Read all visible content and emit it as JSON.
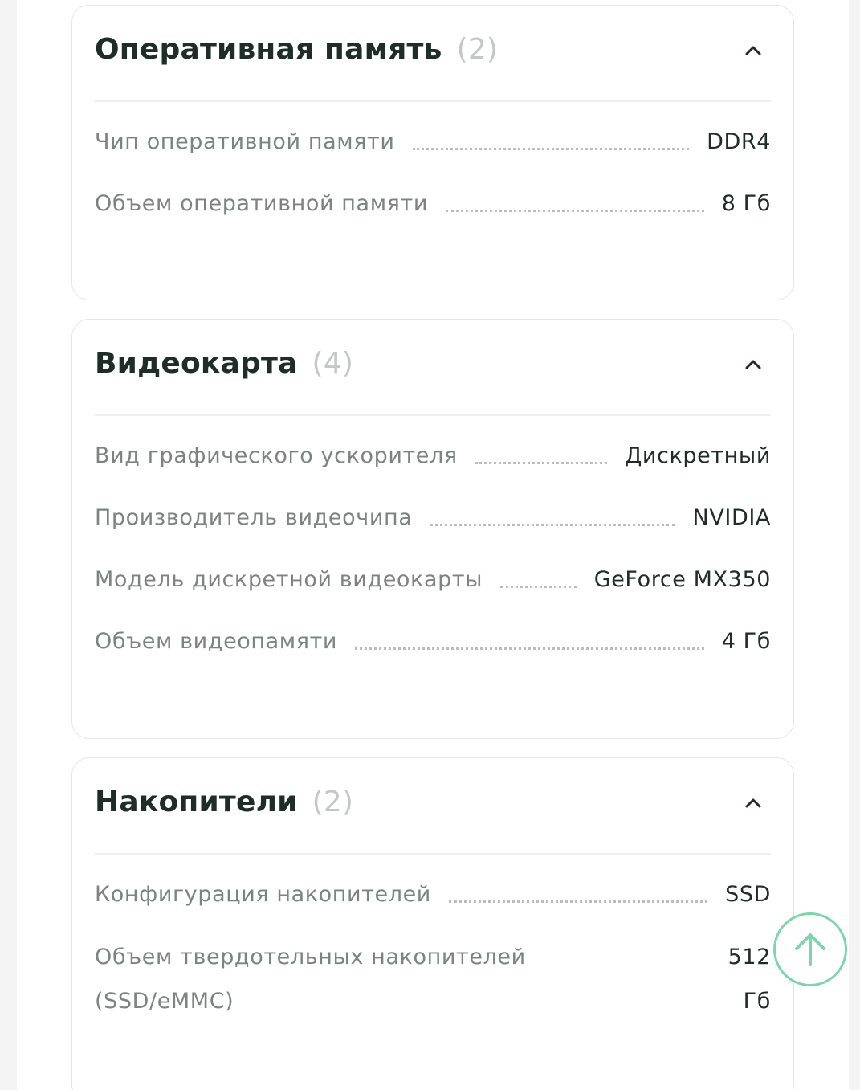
{
  "sections": [
    {
      "title": "Оперативная память",
      "count": "(2)",
      "rows": [
        {
          "label": "Чип оперативной памяти",
          "value": "DDR4"
        },
        {
          "label": "Объем оперативной памяти",
          "value": "8 Гб"
        }
      ]
    },
    {
      "title": "Видеокарта",
      "count": "(4)",
      "rows": [
        {
          "label": "Вид графического ускорителя",
          "value": "Дискретный"
        },
        {
          "label": "Производитель видеочипа",
          "value": "NVIDIA"
        },
        {
          "label": "Модель дискретной видеокарты",
          "value": "GeForce MX350"
        },
        {
          "label": "Объем видеопамяти",
          "value": "4 Гб"
        }
      ]
    },
    {
      "title": "Накопители",
      "count": "(2)",
      "rows": [
        {
          "label": "Конфигурация накопителей",
          "value": "SSD"
        },
        {
          "label": "Объем твердотельных накопителей (SSD/eMMC)",
          "value": "512 Гб"
        }
      ]
    }
  ],
  "icons": {
    "collapse": "chevron-up-icon",
    "scroll_top": "arrow-up-icon"
  },
  "colors": {
    "accent": "#7fd4ac",
    "title": "#1e2d27",
    "label": "#7b8481",
    "count": "#c3c7c5"
  }
}
